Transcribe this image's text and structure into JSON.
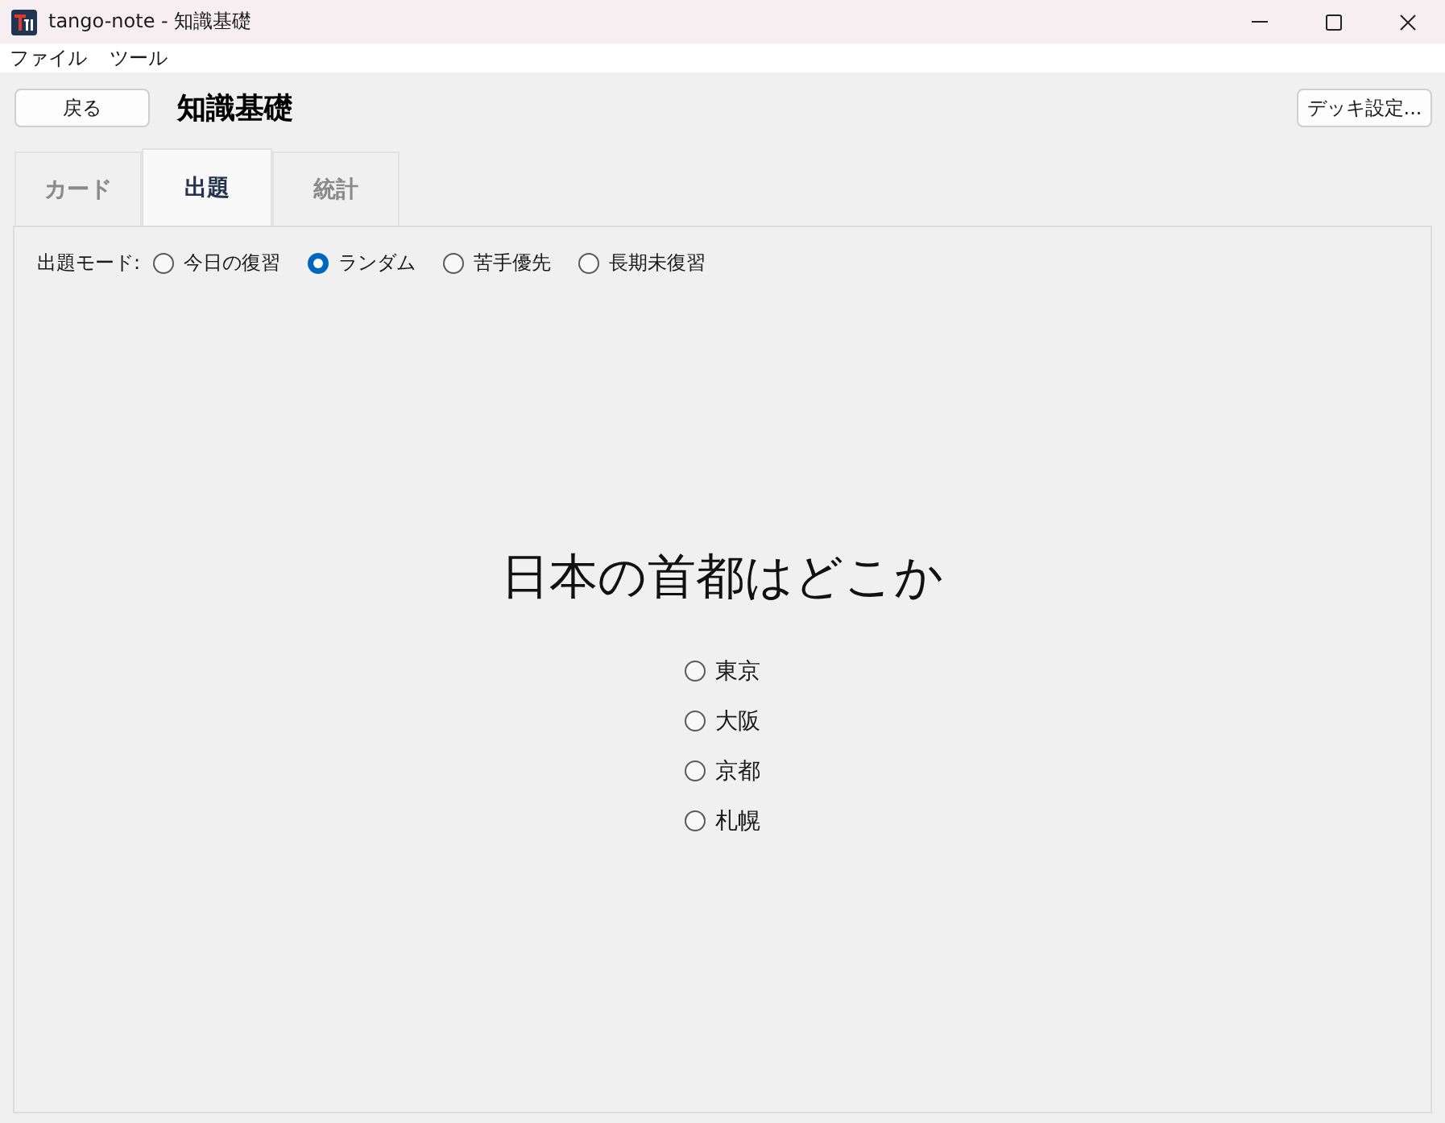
{
  "window": {
    "title": "tango-note - 知識基礎"
  },
  "menu": [
    {
      "label": "ファイル"
    },
    {
      "label": "ツール"
    }
  ],
  "toolbar": {
    "back_button": "戻る",
    "deck_title": "知識基礎",
    "settings_button": "デッキ設定..."
  },
  "tabs": [
    {
      "label": "カード",
      "selected": false
    },
    {
      "label": "出題",
      "selected": true
    },
    {
      "label": "統計",
      "selected": false
    }
  ],
  "mode": {
    "label": "出題モード:",
    "options": [
      {
        "label": "今日の復習",
        "selected": false
      },
      {
        "label": "ランダム",
        "selected": true
      },
      {
        "label": "苦手優先",
        "selected": false
      },
      {
        "label": "長期未復習",
        "selected": false
      }
    ]
  },
  "question": {
    "text": "日本の首都はどこか",
    "choices": [
      {
        "label": "東京",
        "selected": false
      },
      {
        "label": "大阪",
        "selected": false
      },
      {
        "label": "京都",
        "selected": false
      },
      {
        "label": "札幌",
        "selected": false
      }
    ]
  }
}
